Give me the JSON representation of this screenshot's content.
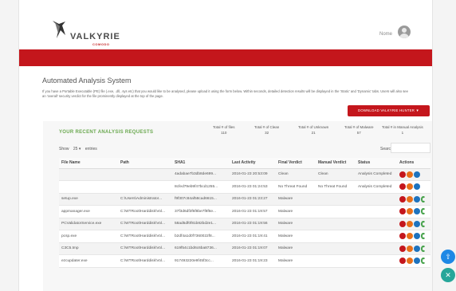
{
  "header": {
    "brand": "VALKYRIE",
    "brand_sub": "COMODO",
    "user": "Nome"
  },
  "main": {
    "title": "Automated Analysis System",
    "description": "If you have a Portable Executable (PE) file (.exe, .dll, .sys etc) that you would like to be analysed, please upload it using the form below. Within seconds, detailed detection results will be displayed in the 'Static' and 'Dynamic' tabs. Users will also see an 'overall' security verdict for the file prominently displayed at the top of the page.",
    "download_button": "DOWNLOAD VALKYRIE HUNTER"
  },
  "panel": {
    "title": "YOUR RECENT ANALYSIS REQUESTS",
    "stats": [
      {
        "label": "Total # of files",
        "value": "110"
      },
      {
        "label": "Total # of Clean",
        "value": "32"
      },
      {
        "label": "Total # of Unknown",
        "value": "21"
      },
      {
        "label": "Total # of Malware",
        "value": "57"
      },
      {
        "label": "Total # in Manual Analysis",
        "value": "1"
      }
    ],
    "show_label": "Show",
    "show_value": "25",
    "entries_label": "entries",
    "search_label": "Search:"
  },
  "table": {
    "columns": [
      "File Name",
      "Path",
      "SHA1",
      "Last Activity",
      "Final Verdict",
      "Manual Verdict",
      "Status",
      "Actions"
    ],
    "rows": [
      [
        "",
        "",
        "4adabae7b3db8de699...",
        "2016-01-23 20:53:09",
        "Clean",
        "Clean",
        "Analysis Completed",
        "rob"
      ],
      [
        "",
        "",
        "8cfed79eb9f47bcd1255...",
        "2016-01-23 01:24:53",
        "No Threat Found",
        "No Threat Found",
        "Analysis Completed",
        "rob"
      ],
      [
        "setup.exe",
        "C:\\Users\\Administrator...",
        "f9f307c84af58cad6615...",
        "2016-01-23 01:23:27",
        "Malware",
        "",
        "",
        "robg"
      ],
      [
        "appmanager.exe",
        "C:\\WTRoot\\Harddisk\\Vol...",
        "37f3d6df3f6f8be7f8f6e...",
        "2016-01-23 01:19:57",
        "Malware",
        "",
        "",
        "robg"
      ],
      [
        "PCValidatorService.exe",
        "C:\\WTRoot\\Harddisk\\Vol...",
        "58ad5df0f81b82bd2e1...",
        "2016-01-23 01:19:56",
        "Malware",
        "",
        "",
        "robg"
      ],
      [
        "pcsp.exe",
        "C:\\WTRoot\\Harddisk\\Vol...",
        "b2df4a1d0f7360022f8...",
        "2016-01-23 01:19:41",
        "Malware",
        "",
        "",
        "robg"
      ],
      [
        "C3C5.tmp",
        "C:\\WTRoot\\Harddisk\\Vol...",
        "619f54c1bd6c6ba8736...",
        "2016-01-23 01:19:07",
        "Malware",
        "",
        "",
        "robg"
      ],
      [
        "ezcupdater.exe",
        "C:\\WTRoot\\Harddisk\\Vol...",
        "917493220e9f45f3cc...",
        "2016-01-23 01:19:23",
        "Malware",
        "",
        "",
        "robg"
      ]
    ]
  },
  "colors": {
    "brand_red": "#c4161c",
    "accent_green": "#6aa84f"
  },
  "icons": {
    "fab_top": "upload-icon",
    "fab_bottom": "close-icon"
  }
}
